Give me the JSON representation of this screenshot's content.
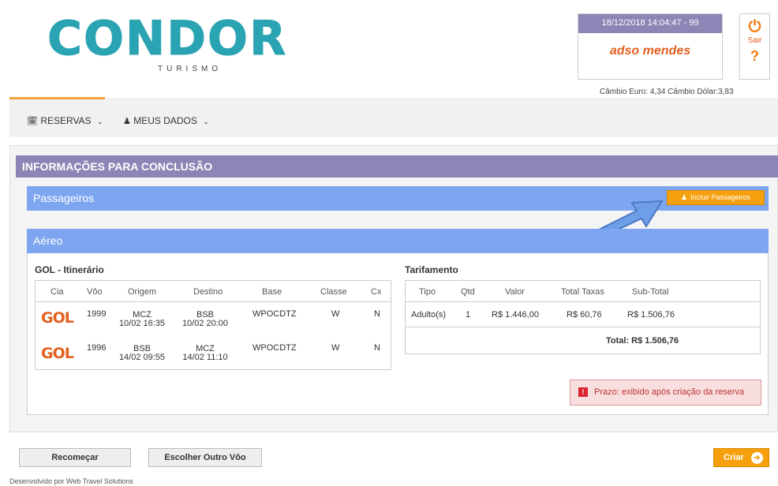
{
  "brand": {
    "name": "CONDOR",
    "sub": "TURISMO"
  },
  "user": {
    "datetime": "18/12/2018 14:04:47 - 99",
    "name": "adso mendes"
  },
  "logout": {
    "label": "Sair",
    "help": "?"
  },
  "cambio": "Câmbio Euro: 4,34   Câmbio Dólar:3,83",
  "nav": {
    "reservas": "RESERVAS",
    "meus_dados": "MEUS DADOS"
  },
  "section_title": "INFORMAÇÕES PARA CONCLUSÃO",
  "passageiros": {
    "title": "Passageiros",
    "button": "Incluir Passageiros"
  },
  "aereo": {
    "title": "Aéreo"
  },
  "itinerario": {
    "title": "GOL - Itinerário",
    "headers": [
      "Cia",
      "Vôo",
      "Origem",
      "Destino",
      "Base",
      "Classe",
      "Cx"
    ],
    "rows": [
      {
        "cia": "GOL",
        "voo": "1999",
        "origem": "MCZ",
        "origem_dt": "10/02 16:35",
        "destino": "BSB",
        "destino_dt": "10/02 20:00",
        "base": "WPOCDTZ",
        "classe": "W",
        "cx": "N"
      },
      {
        "cia": "GOL",
        "voo": "1996",
        "origem": "BSB",
        "origem_dt": "14/02 09:55",
        "destino": "MCZ",
        "destino_dt": "14/02 11:10",
        "base": "WPOCDTZ",
        "classe": "W",
        "cx": "N"
      }
    ]
  },
  "tarifamento": {
    "title": "Tarifamento",
    "headers": [
      "Tipo",
      "Qtd",
      "Valor",
      "Total Taxas",
      "Sub-Total"
    ],
    "row": {
      "tipo": "Adulto(s)",
      "qtd": "1",
      "valor": "R$ 1.446,00",
      "taxas": "R$ 60,76",
      "subtotal": "R$ 1.506,76"
    },
    "total": "Total: R$ 1.506,76"
  },
  "prazo": "Prazo: exibido após criação da reserva",
  "buttons": {
    "recomecar": "Recomeçar",
    "escolher": "Escolher Outro Vôo",
    "criar": "Criar"
  },
  "footer": "Desenvolvido por Web Travel Solutions",
  "colors": {
    "header_purple": "#8b86b5",
    "bar_blue": "#7ea6f0",
    "accent_orange": "#f5a00c"
  }
}
